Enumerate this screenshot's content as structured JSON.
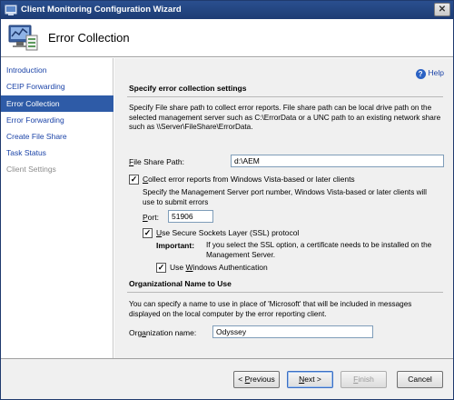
{
  "window": {
    "title": "Client Monitoring Configuration Wizard",
    "close_glyph": "✕"
  },
  "header": {
    "title": "Error Collection"
  },
  "nav": {
    "items": [
      {
        "label": "Introduction",
        "state": "normal"
      },
      {
        "label": "CEIP Forwarding",
        "state": "normal"
      },
      {
        "label": "Error Collection",
        "state": "active"
      },
      {
        "label": "Error Forwarding",
        "state": "normal"
      },
      {
        "label": "Create File Share",
        "state": "normal"
      },
      {
        "label": "Task Status",
        "state": "normal"
      },
      {
        "label": "Client Settings",
        "state": "disabled"
      }
    ]
  },
  "help": {
    "label": "Help",
    "icon_glyph": "?"
  },
  "error_settings": {
    "heading": "Specify error collection settings",
    "description": "Specify File share path to collect error reports. File share path can be local drive path on the selected management server such as C:\\ErrorData or a UNC path to an existing network share such as \\\\Server\\FileShare\\ErrorData.",
    "file_share_label_u": "F",
    "file_share_label_rest": "ile Share Path:",
    "file_share_value": "d:\\AEM",
    "collect_label_u": "C",
    "collect_label_rest": "ollect error reports from Windows Vista-based or later clients",
    "collect_checked": true,
    "port_description": "Specify the Management Server port number, Windows Vista-based or later clients will use to submit errors",
    "port_label_u": "P",
    "port_label_rest": "ort:",
    "port_value": "51906",
    "ssl_label_u": "U",
    "ssl_label_rest": "se Secure Sockets Layer (SSL) protocol",
    "ssl_checked": true,
    "important_label": "Important:",
    "important_text": "If you select the SSL option, a certificate needs to be installed on the Management Server.",
    "win_auth_label_pre": "Use ",
    "win_auth_label_u": "W",
    "win_auth_label_rest": "indows Authentication",
    "win_auth_checked": true
  },
  "org_name": {
    "heading": "Organizational Name to Use",
    "description": "You can specify a name to use in place of 'Microsoft' that will be included in messages displayed on the local computer by the error reporting client.",
    "label_pre": "Org",
    "label_u": "a",
    "label_rest": "nization name:",
    "value": "Odyssey"
  },
  "buttons": {
    "previous_pre": "< ",
    "previous_u": "P",
    "previous_rest": "revious",
    "next_u": "N",
    "next_rest": "ext >",
    "finish_u": "F",
    "finish_rest": "inish",
    "cancel": "Cancel"
  },
  "colors": {
    "title_bar": "#2a4f8f",
    "nav_active": "#2e5ba7",
    "link": "#1c44a8"
  }
}
